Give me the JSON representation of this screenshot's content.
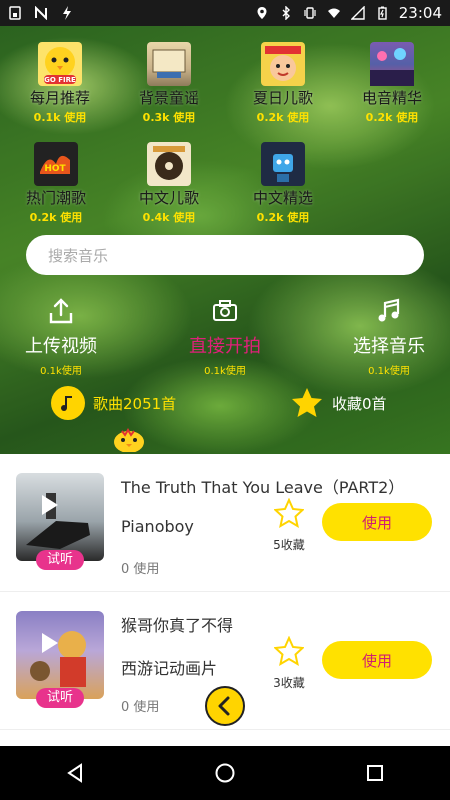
{
  "status_bar": {
    "time": "23:04"
  },
  "categories": [
    {
      "name": "每月推荐",
      "uses": "0.1k 使用",
      "thumb_text": "GO FIRE",
      "thumb_bg": "#fde36a"
    },
    {
      "name": "背景童谣",
      "uses": "0.3k 使用",
      "thumb_text": "",
      "thumb_bg": "#c9b28a"
    },
    {
      "name": "夏日儿歌",
      "uses": "0.2k 使用",
      "thumb_text": "",
      "thumb_bg": "#f5d24a"
    },
    {
      "name": "电音精华",
      "uses": "0.2k 使用",
      "thumb_text": "",
      "thumb_bg": "#5560a8"
    },
    {
      "name": "热门潮歌",
      "uses": "0.2k 使用",
      "thumb_text": "HOT",
      "thumb_bg": "#222222"
    },
    {
      "name": "中文儿歌",
      "uses": "0.4k 使用",
      "thumb_text": "",
      "thumb_bg": "#f2e6c8"
    },
    {
      "name": "中文精选",
      "uses": "0.2k 使用",
      "thumb_text": "",
      "thumb_bg": "#1f2b44"
    }
  ],
  "search": {
    "placeholder": "搜索音乐"
  },
  "actions": [
    {
      "label": "上传视频",
      "uses": "0.1k使用",
      "icon": "upload-icon"
    },
    {
      "label": "直接开拍",
      "uses": "0.1k使用",
      "icon": "camera-icon"
    },
    {
      "label": "选择音乐",
      "uses": "0.1k使用",
      "icon": "music-note-icon"
    }
  ],
  "stats": {
    "songs": "歌曲2051首",
    "favorites": "收藏0首"
  },
  "songs": [
    {
      "title": "The Truth That You Leave（PART2）",
      "artist": "Pianoboy",
      "uses": "0 使用",
      "fav_count": "5收藏",
      "tag": "试听",
      "button": "使用"
    },
    {
      "title": "猴哥你真了不得",
      "artist": "西游记动画片",
      "uses": "0 使用",
      "fav_count": "3收藏",
      "tag": "试听",
      "button": "使用"
    }
  ],
  "colors": {
    "accent_yellow": "#ffe100",
    "accent_pink": "#e0207a"
  }
}
